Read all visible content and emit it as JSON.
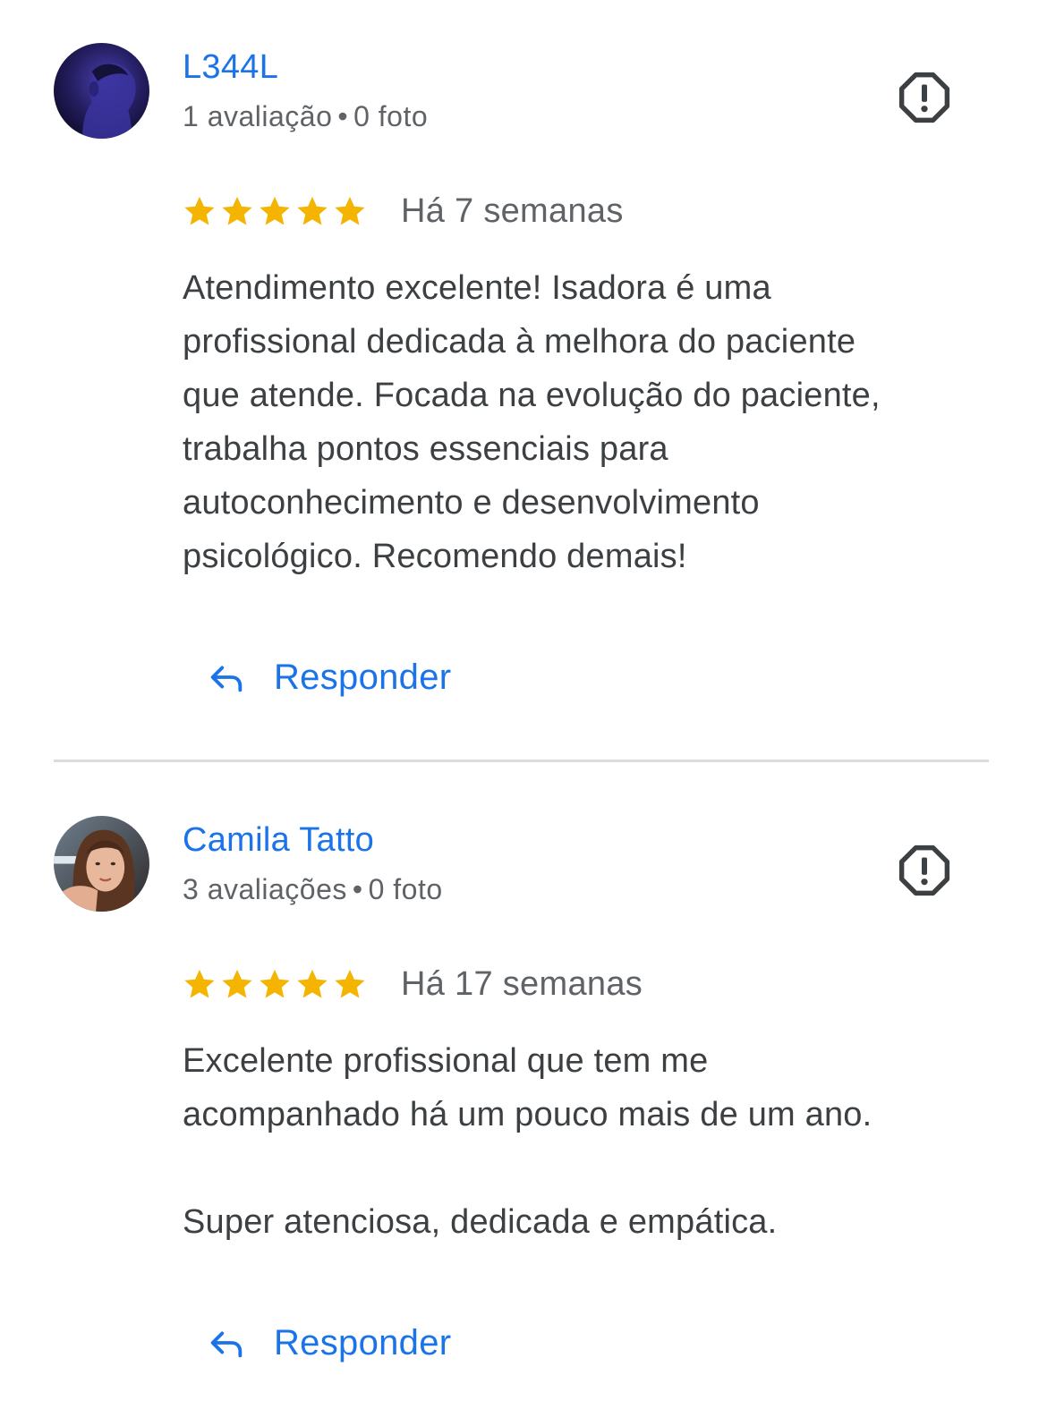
{
  "reviews": [
    {
      "author": "L344L",
      "meta_reviews": "1 avaliação",
      "meta_separator": "•",
      "meta_photos": "0 foto",
      "rating": 5,
      "date": "Há 7 semanas",
      "text": "Atendimento excelente! Isadora é uma\nprofissional dedicada à melhora do paciente\nque atende. Focada na evolução do paciente,\ntrabalha pontos essenciais para\nautoconhecimento e desenvolvimento\npsicológico. Recomendo demais!",
      "reply_label": "Responder"
    },
    {
      "author": "Camila Tatto",
      "meta_reviews": "3 avaliações",
      "meta_separator": "•",
      "meta_photos": "0 foto",
      "rating": 5,
      "date": "Há 17 semanas",
      "text": "Excelente profissional que tem me\nacompanhado há um pouco mais de um ano.\n\nSuper atenciosa, dedicada e empática.",
      "reply_label": "Responder"
    }
  ],
  "icons": {
    "report": "report-flag-icon",
    "star": "star-icon",
    "reply": "reply-arrow-icon"
  },
  "colors": {
    "link_blue": "#1a73e8",
    "star_gold": "#f4b400",
    "secondary_text": "#5f6368",
    "primary_text": "#3c4043",
    "divider": "#dadce0"
  }
}
